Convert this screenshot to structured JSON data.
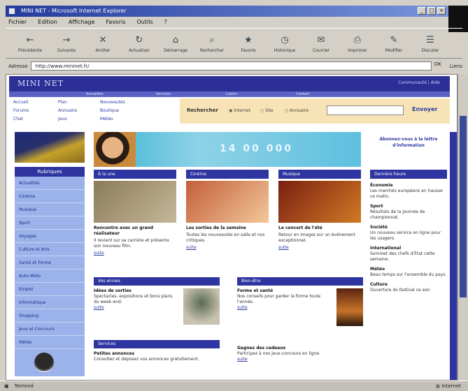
{
  "window": {
    "title": "MINI NET - Microsoft Internet Explorer",
    "controls": [
      "_",
      "□",
      "×"
    ]
  },
  "menu": [
    "Fichier",
    "Edition",
    "Affichage",
    "Favoris",
    "Outils",
    "?"
  ],
  "toolbar": [
    {
      "label": "Précédente",
      "icon": "back-arrow-icon",
      "glyph": "←"
    },
    {
      "label": "Suivante",
      "icon": "forward-arrow-icon",
      "glyph": "→"
    },
    {
      "label": "Arrêter",
      "icon": "stop-icon",
      "glyph": "✕"
    },
    {
      "label": "Actualiser",
      "icon": "refresh-icon",
      "glyph": "↻"
    },
    {
      "label": "Démarrage",
      "icon": "home-icon",
      "glyph": "⌂"
    },
    {
      "label": "Rechercher",
      "icon": "search-icon",
      "glyph": "⌕"
    },
    {
      "label": "Favoris",
      "icon": "favorites-icon",
      "glyph": "★"
    },
    {
      "label": "Historique",
      "icon": "history-icon",
      "glyph": "◷"
    },
    {
      "label": "Courrier",
      "icon": "mail-icon",
      "glyph": "✉"
    },
    {
      "label": "Imprimer",
      "icon": "print-icon",
      "glyph": "⎙"
    },
    {
      "label": "Modifier",
      "icon": "edit-icon",
      "glyph": "✎"
    },
    {
      "label": "Discuter",
      "icon": "discuss-icon",
      "glyph": "☰"
    }
  ],
  "address": {
    "label": "Adresse",
    "url": "http://www.mininet.fr/",
    "go": "OK",
    "links": "Liens"
  },
  "site": {
    "logo": "MINI NET",
    "head_links": "Communauté | Aide",
    "nav_band": [
      "Actualités",
      "Services",
      "Loisirs",
      "Contact"
    ],
    "top_links": [
      "Accueil",
      "Plan",
      "Nouveautés",
      "Forums",
      "Annuaire",
      "Boutique",
      "Chat",
      "Jeux",
      "Météo"
    ],
    "search": {
      "label": "Rechercher",
      "options": [
        "Internet",
        "Site",
        "Annuaire"
      ],
      "button": "Envoyer"
    },
    "banner_text": "14 00 000",
    "left_nav": {
      "heading": "Rubriques",
      "items": [
        "Actualités",
        "Cinéma",
        "Musique",
        "Sport",
        "Voyages",
        "Culture et Arts",
        "Santé et Forme",
        "Auto-Moto",
        "Emploi",
        "Informatique",
        "Shopping",
        "Jeux et Concours",
        "Météo"
      ]
    },
    "columns": [
      {
        "header": "À la une",
        "title": "Rencontre avec un grand réalisateur",
        "body": "Il revient sur sa carrière et présente son nouveau film.",
        "more": "suite",
        "color_a": "#8a7b5a",
        "color_b": "#c7b79a"
      },
      {
        "header": "Cinéma",
        "title": "Les sorties de la semaine",
        "body": "Toutes les nouveautés en salle et nos critiques.",
        "more": "suite",
        "color_a": "#c35f3a",
        "color_b": "#f3c79a"
      },
      {
        "header": "Musique",
        "title": "Le concert de l'été",
        "body": "Retour en images sur un événement exceptionnel.",
        "more": "suite",
        "color_a": "#7a1f12",
        "color_b": "#d07a24"
      }
    ],
    "boxes": [
      {
        "header": "Vos envies",
        "title": "Idées de sorties",
        "body": "Spectacles, expositions et bons plans du week-end.",
        "more": "suite"
      },
      {
        "header": "Bien-être",
        "title": "Forme et santé",
        "body": "Nos conseils pour garder la forme toute l'année.",
        "more": "suite"
      },
      {
        "header": "Services",
        "title": "Petites annonces",
        "body": "Consultez et déposez vos annonces gratuitement.",
        "more": ""
      },
      {
        "header": "",
        "title": "Gagnez des cadeaux",
        "body": "Participez à nos jeux-concours en ligne.",
        "more": "suite"
      }
    ],
    "promo": "Abonnez-vous à la lettre d'information",
    "right": {
      "heading": "Dernière heure",
      "items": [
        {
          "title": "Économie",
          "body": "Les marchés européens en hausse ce matin."
        },
        {
          "title": "Sport",
          "body": "Résultats de la journée de championnat."
        },
        {
          "title": "Société",
          "body": "Un nouveau service en ligne pour les usagers."
        },
        {
          "title": "International",
          "body": "Sommet des chefs d'État cette semaine."
        },
        {
          "title": "Météo",
          "body": "Beau temps sur l'ensemble du pays."
        },
        {
          "title": "Culture",
          "body": "Ouverture du festival ce soir."
        }
      ]
    }
  },
  "status": {
    "text": "Terminé",
    "zone": "Internet"
  }
}
